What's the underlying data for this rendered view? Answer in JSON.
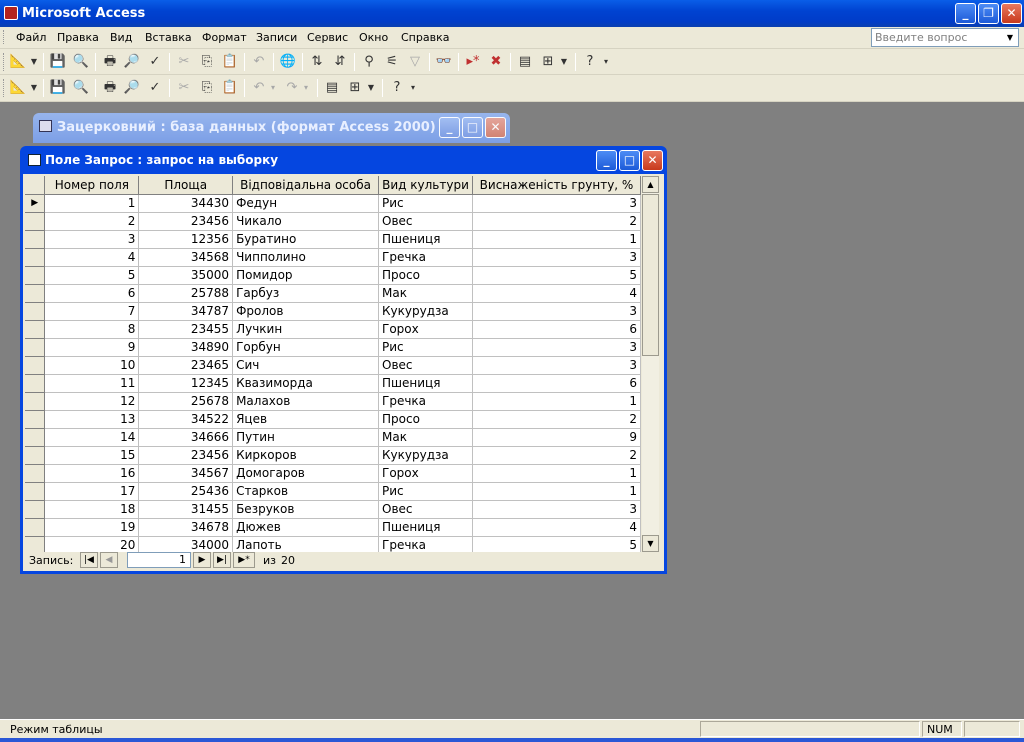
{
  "app": {
    "title": "Microsoft Access"
  },
  "menu": [
    "Файл",
    "Правка",
    "Вид",
    "Вставка",
    "Формат",
    "Записи",
    "Сервис",
    "Окно",
    "Справка"
  ],
  "ask": {
    "placeholder": "Введите вопрос"
  },
  "db_window": {
    "title": "Зацерковний : база данных (формат Access 2000)"
  },
  "query_window": {
    "title": "Поле Запрос : запрос на выборку"
  },
  "table": {
    "columns": [
      "Номер поля",
      "Площа",
      "Відповідальна особа",
      "Вид культури",
      "Виснаженість грунту, %"
    ],
    "rows": [
      [
        "1",
        "34430",
        "Федун",
        "Рис",
        "3"
      ],
      [
        "2",
        "23456",
        "Чикало",
        "Овес",
        "2"
      ],
      [
        "3",
        "12356",
        "Буратино",
        "Пшениця",
        "1"
      ],
      [
        "4",
        "34568",
        "Чипполино",
        "Гречка",
        "3"
      ],
      [
        "5",
        "35000",
        "Помидор",
        "Просо",
        "5"
      ],
      [
        "6",
        "25788",
        "Гарбуз",
        "Мак",
        "4"
      ],
      [
        "7",
        "34787",
        "Фролов",
        "Кукурудза",
        "3"
      ],
      [
        "8",
        "23455",
        "Лучкин",
        "Горох",
        "6"
      ],
      [
        "9",
        "34890",
        "Горбун",
        "Рис",
        "3"
      ],
      [
        "10",
        "23465",
        "Сич",
        "Овес",
        "3"
      ],
      [
        "11",
        "12345",
        "Квазиморда",
        "Пшениця",
        "6"
      ],
      [
        "12",
        "25678",
        "Малахов",
        "Гречка",
        "1"
      ],
      [
        "13",
        "34522",
        "Яцев",
        "Просо",
        "2"
      ],
      [
        "14",
        "34666",
        "Путин",
        "Мак",
        "9"
      ],
      [
        "15",
        "23456",
        "Киркоров",
        "Кукурудза",
        "2"
      ],
      [
        "16",
        "34567",
        "Домогаров",
        "Горох",
        "1"
      ],
      [
        "17",
        "25436",
        "Старков",
        "Рис",
        "1"
      ],
      [
        "18",
        "31455",
        "Безруков",
        "Овес",
        "3"
      ],
      [
        "19",
        "34678",
        "Дюжев",
        "Пшениця",
        "4"
      ],
      [
        "20",
        "34000",
        "Лапоть",
        "Гречка",
        "5"
      ]
    ]
  },
  "navigator": {
    "label": "Запись:",
    "current": "1",
    "of_label": "из",
    "total": "20"
  },
  "status": {
    "mode": "Режим таблицы",
    "num": "NUM"
  }
}
